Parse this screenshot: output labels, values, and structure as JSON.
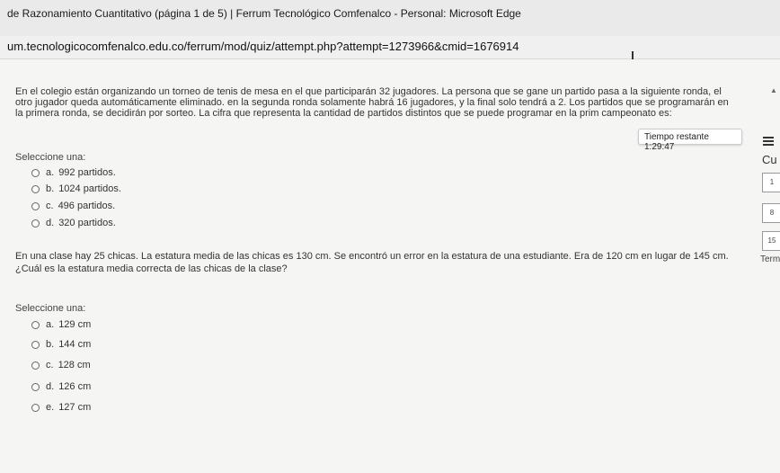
{
  "window": {
    "title": "de Razonamiento Cuantitativo (página 1 de 5) | Ferrum Tecnológico Comfenalco - Personal: Microsoft Edge",
    "url": "um.tecnologicocomfenalco.edu.co/ferrum/mod/quiz/attempt.php?attempt=1273966&cmid=1676914"
  },
  "question1": {
    "text": "En el colegio están organizando un torneo de tenis de mesa en el que participarán 32 jugadores. La persona que se gane un partido pasa a la siguiente ronda, el otro jugador queda automáticamente eliminado. en la segunda ronda solamente habrá 16 jugadores, y la final solo tendrá a 2. Los partidos que se programarán en la primera ronda, se decidirán por sorteo. La cifra que representa la cantidad de partidos distintos que se puede programar en la prim campeonato es:",
    "select_label": "Seleccione una:",
    "options": [
      {
        "letter": "a.",
        "text": "992 partidos."
      },
      {
        "letter": "b.",
        "text": "1024 partidos."
      },
      {
        "letter": "c.",
        "text": "496 partidos."
      },
      {
        "letter": "d.",
        "text": "320 partidos."
      }
    ]
  },
  "timer": {
    "label": "Tiempo restante 1:29:47"
  },
  "question2": {
    "line1": "En una clase hay 25 chicas. La estatura media de las chicas es 130 cm. Se encontró un error en la estatura de una estudiante. Era de 120 cm en lugar de 145 cm.",
    "line2": "¿Cuál es la estatura media correcta de las chicas de la clase?",
    "select_label": "Seleccione una:",
    "options": [
      {
        "letter": "a.",
        "text": "129 cm"
      },
      {
        "letter": "b.",
        "text": "144 cm"
      },
      {
        "letter": "c.",
        "text": "128 cm"
      },
      {
        "letter": "d.",
        "text": "126 cm"
      },
      {
        "letter": "e.",
        "text": "127 cm"
      }
    ]
  },
  "side_panel": {
    "heading": "Cu",
    "nav_items": [
      "1",
      "8",
      "15"
    ],
    "term_label": "Term"
  }
}
